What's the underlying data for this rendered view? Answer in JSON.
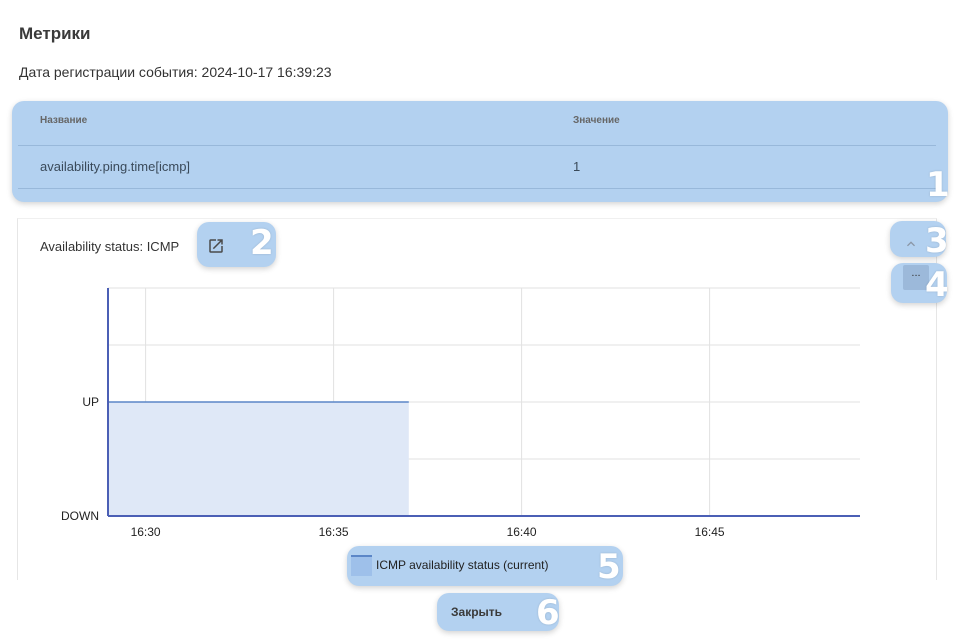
{
  "page": {
    "title": "Метрики",
    "event_date": "Дата регистрации события: 2024-10-17 16:39:23"
  },
  "table": {
    "headers": [
      "Название",
      "Значение"
    ],
    "rows": [
      {
        "name": "availability.ping.time[icmp]",
        "value": "1"
      }
    ]
  },
  "chart_panel": {
    "title": "Availability status: ICMP",
    "more_label": "...",
    "collapse_icon": "chevron-up-icon",
    "open_icon": "open-in-new-icon"
  },
  "chart_data": {
    "type": "area",
    "title": "Availability status: ICMP",
    "x": [
      "16:29",
      "16:37"
    ],
    "x_ticks": [
      "16:30",
      "16:35",
      "16:40",
      "16:45"
    ],
    "y_ticks": [
      "DOWN",
      "UP"
    ],
    "series": [
      {
        "name": "ICMP availability status (current)",
        "x": [
          "16:29",
          "16:37"
        ],
        "values": [
          "UP",
          "UP"
        ]
      }
    ],
    "grid": true,
    "legend": "bottom"
  },
  "legend": {
    "label": "ICMP availability status (current)"
  },
  "actions": {
    "close_label": "Закрыть"
  },
  "colors": {
    "highlight": "#b3d1f0",
    "series_line": "#5b86c7",
    "series_fill": "#dfe8f7",
    "axis": "#4b5fb5"
  },
  "annotations": [
    "1",
    "2",
    "3",
    "4",
    "5",
    "6"
  ]
}
